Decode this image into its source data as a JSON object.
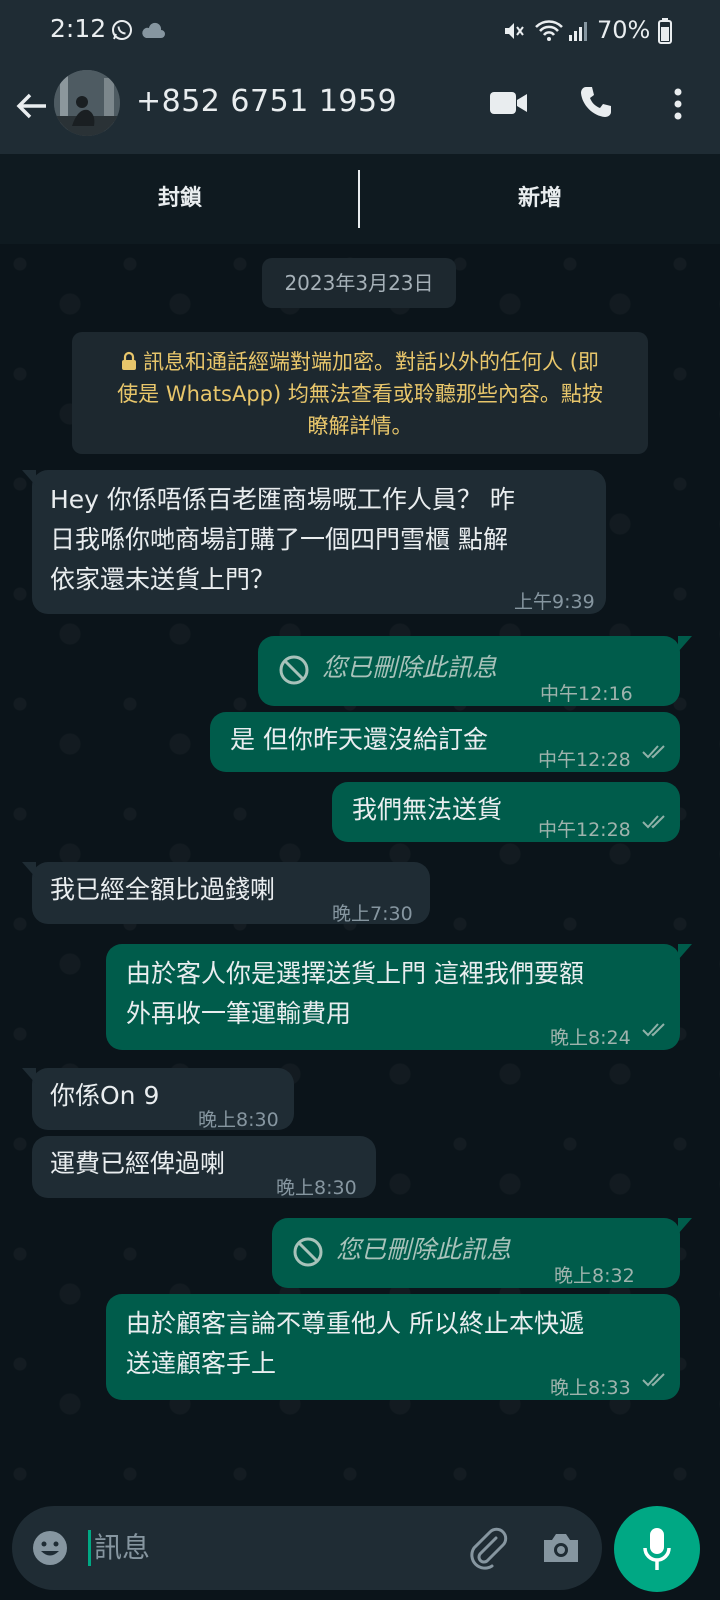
{
  "status_bar": {
    "time": "2:12",
    "battery": "70%"
  },
  "header": {
    "contact": "+852 6751 1959"
  },
  "actions": {
    "block": "封鎖",
    "add": "新增"
  },
  "chat": {
    "date_chip": "2023年3月23日",
    "encryption_notice": "訊息和通話經端對端加密。對話以外的任何人 (即使是 WhatsApp) 均無法查看或聆聽那些內容。點按瞭解詳情。",
    "messages": [
      {
        "dir": "in",
        "text": "Hey 你係唔係百老匯商場嘅工作人員？ 昨日我喺你哋商場訂購了一個四門雪櫃 點解依家還未送貨上門？",
        "time": "上午9:39"
      },
      {
        "dir": "out",
        "deleted": true,
        "text": "您已刪除此訊息",
        "time": "中午12:16"
      },
      {
        "dir": "out",
        "text": "是 但你昨天還沒給訂金",
        "time": "中午12:28",
        "read": true
      },
      {
        "dir": "out",
        "text": "我們無法送貨",
        "time": "中午12:28",
        "read": true
      },
      {
        "dir": "in",
        "text": "我已經全額比過錢喇",
        "time": "晚上7:30"
      },
      {
        "dir": "out",
        "text": "由於客人你是選擇送貨上門 這裡我們要額外再收一筆運輸費用",
        "time": "晚上8:24",
        "read": true
      },
      {
        "dir": "in",
        "text": "你係On 9",
        "time": "晚上8:30"
      },
      {
        "dir": "in",
        "text": "運費已經俾過喇",
        "time": "晚上8:30"
      },
      {
        "dir": "out",
        "deleted": true,
        "text": "您已刪除此訊息",
        "time": "晚上8:32"
      },
      {
        "dir": "out",
        "text": "由於顧客言論不尊重他人 所以終止本快遞送達顧客手上",
        "time": "晚上8:33",
        "read": true
      }
    ],
    "line_texts": {
      "m0_l1": "Hey 你係唔係百老匯商場嘅工作人員？ 昨",
      "m0_l2": "日我喺你哋商場訂購了一個四門雪櫃 點解",
      "m0_l3": "依家還未送貨上門？",
      "m5_l1": "由於客人你是選擇送貨上門 這裡我們要額",
      "m5_l2": "外再收一筆運輸費用",
      "m9_l1": "由於顧客言論不尊重他人 所以終止本快遞",
      "m9_l2": "送達顧客手上",
      "notice_l1": "訊息和通話經端對端加密。對話以外的任何人 (即",
      "notice_l2": "使是 WhatsApp) 均無法查看或聆聽那些內容。點按",
      "notice_l3": "瞭解詳情。"
    }
  },
  "composer": {
    "placeholder": "訊息"
  },
  "colors": {
    "incoming": "#1f2c34",
    "outgoing": "#005c4b",
    "accent": "#00a884",
    "notice_text": "#e8c66b"
  },
  "icons": [
    "whatsapp-icon",
    "cloud-icon",
    "mute-icon",
    "wifi-icon",
    "signal-icon",
    "battery-icon",
    "back-arrow-icon",
    "video-call-icon",
    "voice-call-icon",
    "more-options-icon",
    "lock-icon",
    "blocked-circle-icon",
    "double-check-icon",
    "emoji-icon",
    "paperclip-icon",
    "camera-icon",
    "microphone-icon"
  ]
}
